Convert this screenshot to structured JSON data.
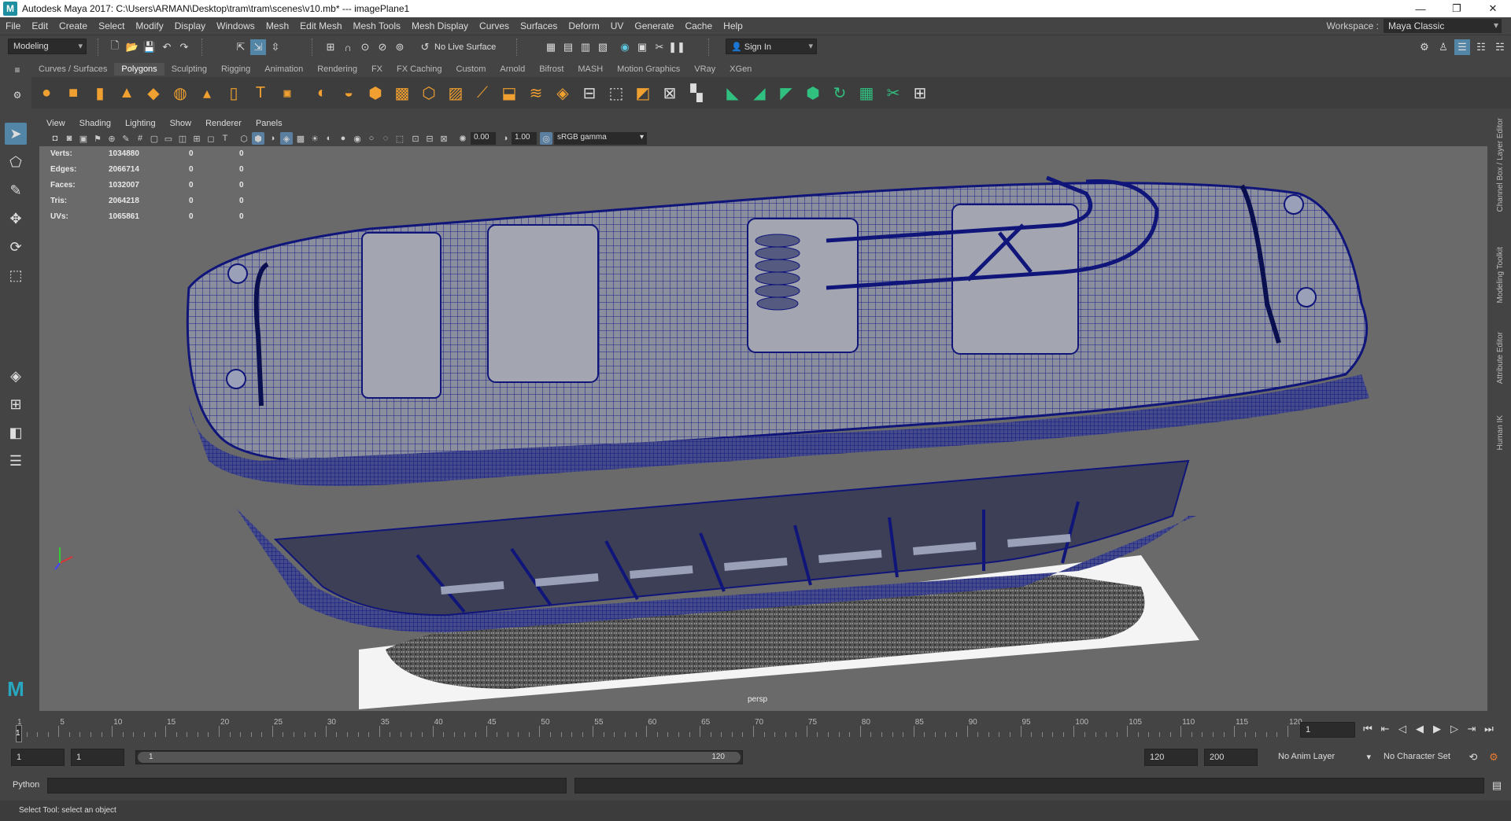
{
  "window": {
    "title": "Autodesk Maya 2017: C:\\Users\\ARMAN\\Desktop\\tram\\tram\\scenes\\v10.mb*   ---   imagePlane1",
    "controls": [
      "—",
      "❐",
      "✕"
    ]
  },
  "menu": [
    "File",
    "Edit",
    "Create",
    "Select",
    "Modify",
    "Display",
    "Windows",
    "Mesh",
    "Edit Mesh",
    "Mesh Tools",
    "Mesh Display",
    "Curves",
    "Surfaces",
    "Deform",
    "UV",
    "Generate",
    "Cache",
    "Help"
  ],
  "workspace": {
    "label": "Workspace :",
    "value": "Maya Classic"
  },
  "status_line": {
    "menu_set": "Modeling",
    "live_surface": "No Live Surface",
    "sign_in": "Sign In"
  },
  "shelf_tabs": [
    "Curves / Surfaces",
    "Polygons",
    "Sculpting",
    "Rigging",
    "Animation",
    "Rendering",
    "FX",
    "FX Caching",
    "Custom",
    "Arnold",
    "Bifrost",
    "MASH",
    "Motion Graphics",
    "VRay",
    "XGen"
  ],
  "active_shelf_tab": "Polygons",
  "panel_menu": [
    "View",
    "Shading",
    "Lighting",
    "Show",
    "Renderer",
    "Panels"
  ],
  "panel_toolbar": {
    "exposure": "0.00",
    "gamma": "1.00",
    "color_space": "sRGB gamma"
  },
  "hud": [
    {
      "label": "Verts:",
      "v1": "1034880",
      "v2": "0",
      "v3": "0"
    },
    {
      "label": "Edges:",
      "v1": "2066714",
      "v2": "0",
      "v3": "0"
    },
    {
      "label": "Faces:",
      "v1": "1032007",
      "v2": "0",
      "v3": "0"
    },
    {
      "label": "Tris:",
      "v1": "2064218",
      "v2": "0",
      "v3": "0"
    },
    {
      "label": "UVs:",
      "v1": "1065861",
      "v2": "0",
      "v3": "0"
    }
  ],
  "viewport_label": "persp",
  "right_tabs": [
    "Channel Box / Layer Editor",
    "Modeling Toolkit",
    "Attribute Editor",
    "Human IK"
  ],
  "timeline": {
    "ticks": [
      "1",
      "5",
      "10",
      "15",
      "20",
      "25",
      "30",
      "35",
      "40",
      "45",
      "50",
      "55",
      "60",
      "65",
      "70",
      "75",
      "80",
      "85",
      "90",
      "95",
      "100",
      "105",
      "110",
      "115",
      "120"
    ],
    "current_frame": "1"
  },
  "range": {
    "start": "1",
    "playback_start": "1",
    "slider_start": "1",
    "slider_end": "120",
    "playback_end": "120",
    "end": "200",
    "anim_layer": "No Anim Layer",
    "character_set": "No Character Set"
  },
  "command_line": {
    "language": "Python"
  },
  "help_line": "Select Tool: select an object",
  "colors": {
    "accent": "#5285a6",
    "wire": "#1a1f8a",
    "viewport_bg": "#6a6a6a"
  }
}
